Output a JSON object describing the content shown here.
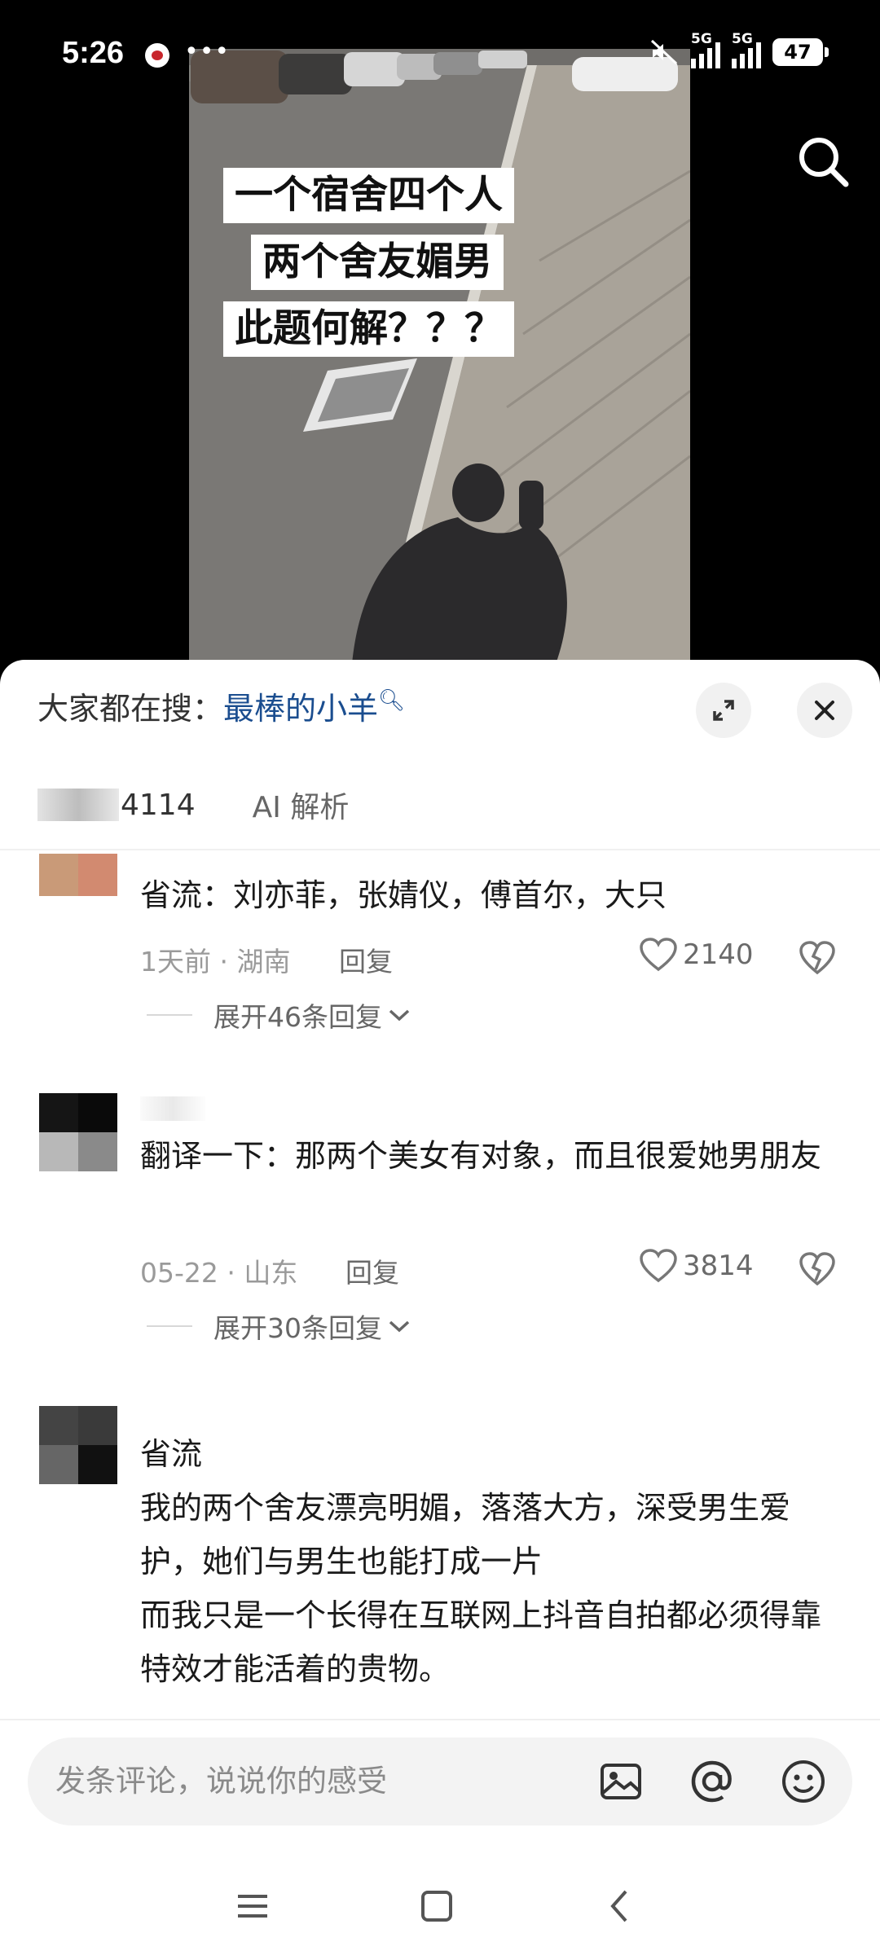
{
  "status_bar": {
    "time": "5:26",
    "notif_icon": "red-app-icon",
    "more_indicator": "•••",
    "signal_1_label": "5G",
    "signal_2_label": "5G",
    "battery_level": "47"
  },
  "video": {
    "caption_lines": [
      "一个宿舍四个人",
      "两个舍友媚男",
      "此题何解？？？"
    ],
    "search_icon": "search-icon"
  },
  "sheet": {
    "search_prefix": "大家都在搜：",
    "search_term": "最棒的小羊",
    "expand_icon": "expand-icon",
    "close_icon": "close-icon",
    "tab_count_label": "4114",
    "tab_ai_label": "AI 解析"
  },
  "comments": [
    {
      "text": "省流：刘亦菲，张婧仪，傅首尔，大只",
      "date": "1天前",
      "location": "湖南",
      "reply_label": "回复",
      "likes": "2140",
      "expand_label": "展开46条回复"
    },
    {
      "text": "翻译一下：那两个美女有对象，而且很爱她男朋友",
      "date": "05-22",
      "location": "山东",
      "reply_label": "回复",
      "likes": "3814",
      "expand_label": "展开30条回复"
    },
    {
      "text_lines": [
        "省流",
        "我的两个舍友漂亮明媚，落落大方，深受男生爱护，她们与男生也能打成一片",
        "而我只是一个长得在互联网上抖音自拍都必须得靠特效才能活着的贵物。"
      ]
    }
  ],
  "input": {
    "placeholder": "发条评论，说说你的感受",
    "icons": [
      "image-icon",
      "at-icon",
      "emoji-icon"
    ]
  },
  "nav": {
    "icons": [
      "menu-icon",
      "home-icon",
      "back-icon"
    ]
  }
}
